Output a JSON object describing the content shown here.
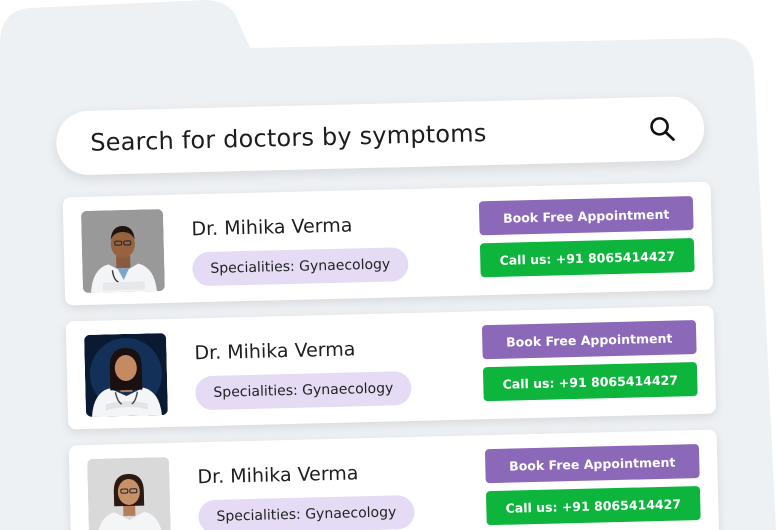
{
  "search": {
    "placeholder": "Search for doctors by symptoms"
  },
  "colors": {
    "folder_bg": "#eef1f4",
    "pill_bg": "#e5dbf5",
    "book_button": "#8b68b8",
    "call_button": "#0eb53c"
  },
  "doctors": [
    {
      "name": "Dr. Mihika Verma",
      "specialities": "Specialities: Gynaecology",
      "book_label": "Book Free Appointment",
      "call_label": "Call us: +91 8065414427",
      "avatar": "male-doctor-photo"
    },
    {
      "name": "Dr. Mihika Verma",
      "specialities": "Specialities: Gynaecology",
      "book_label": "Book Free Appointment",
      "call_label": "Call us: +91 8065414427",
      "avatar": "female-doctor-photo"
    },
    {
      "name": "Dr. Mihika Verma",
      "specialities": "Specialities: Gynaecology",
      "book_label": "Book Free Appointment",
      "call_label": "Call us: +91 8065414427",
      "avatar": "female-doctor-photo"
    }
  ]
}
